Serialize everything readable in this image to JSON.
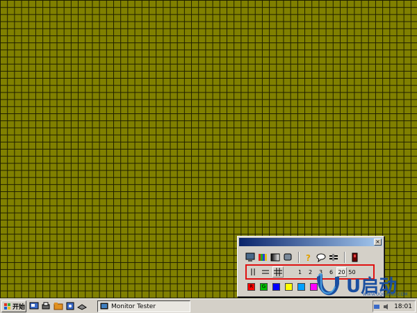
{
  "taskbar": {
    "start_label": "开始",
    "task_title": "Monitor Tester",
    "clock": "18:01"
  },
  "panel": {
    "close_label": "×",
    "grid_sizes": [
      "1",
      "2",
      "3",
      "6",
      "20",
      "50"
    ],
    "active_grid_size": "20",
    "swatch_labels": [
      "R",
      "G"
    ]
  },
  "watermark": {
    "brand": "U启动",
    "site": "WWW.UQIDONG.COM"
  },
  "colors": {
    "desktop_fill": "#808000",
    "grid_line": "#1c1c00",
    "highlight": "#e01010",
    "swatches": [
      "#ff0000",
      "#00c000",
      "#0000ff",
      "#ffff00",
      "#00a0ff",
      "#ff00ff"
    ]
  }
}
